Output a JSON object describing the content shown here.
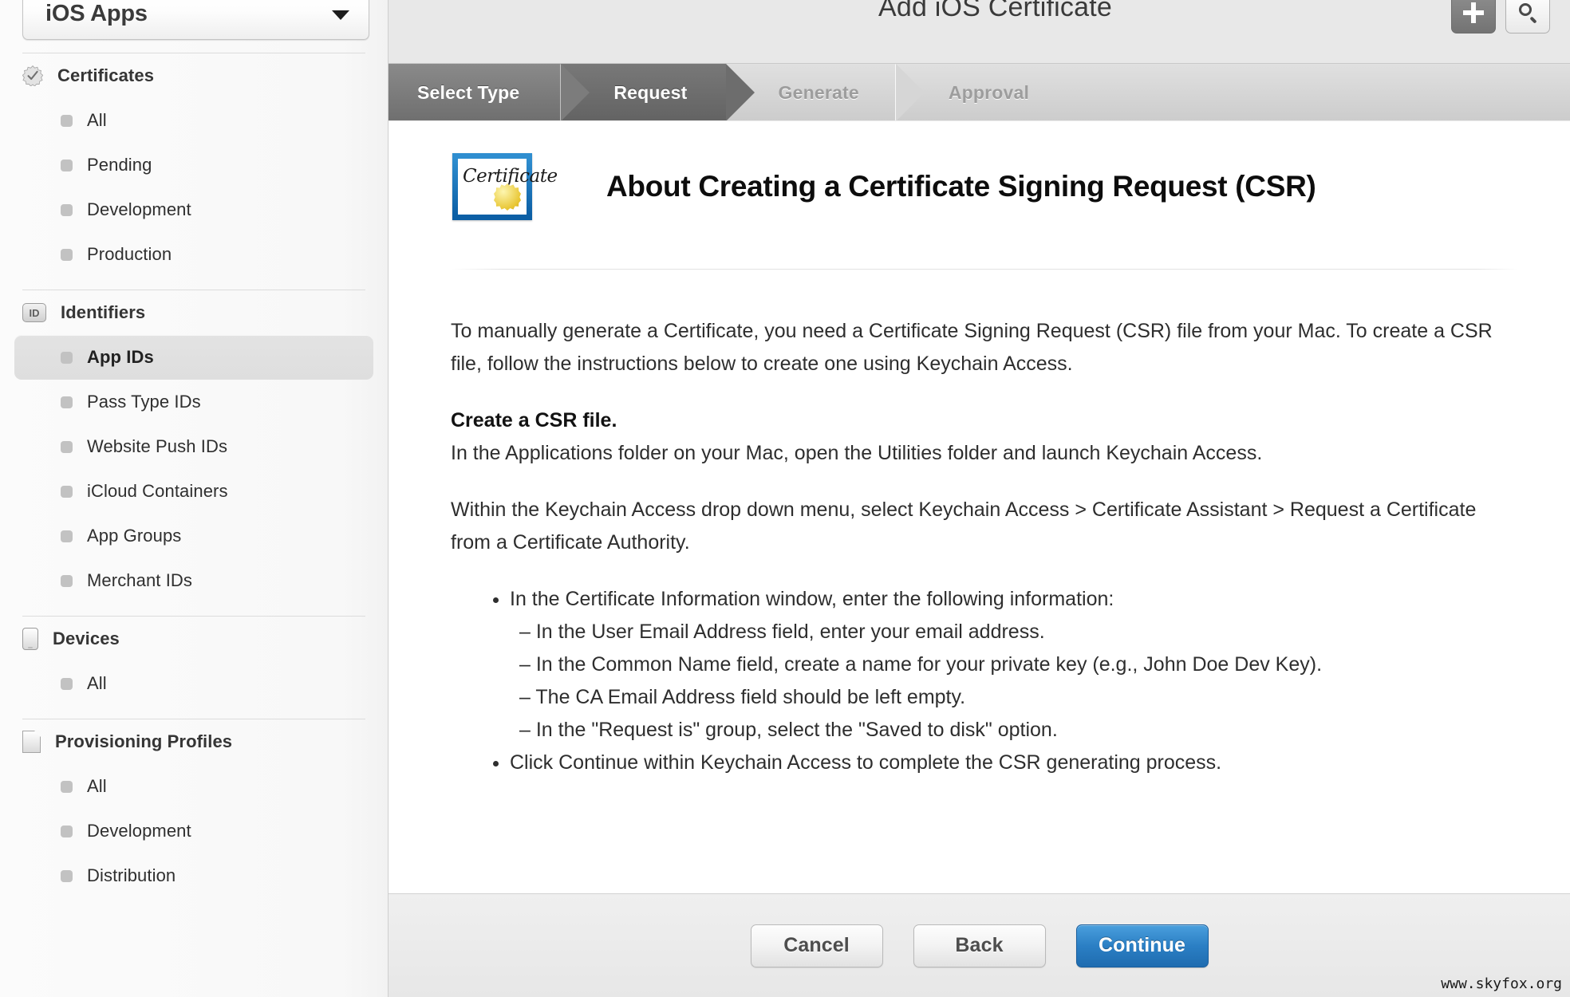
{
  "sidebar": {
    "team_select": {
      "value": "iOS Apps",
      "icon": "chevron-down-icon"
    },
    "groups": [
      {
        "title": "Certificates",
        "icon": "certificate-badge-icon",
        "items": [
          {
            "label": "All",
            "selected": false
          },
          {
            "label": "Pending",
            "selected": false
          },
          {
            "label": "Development",
            "selected": false
          },
          {
            "label": "Production",
            "selected": false
          }
        ]
      },
      {
        "title": "Identifiers",
        "icon": "id-badge-icon",
        "items": [
          {
            "label": "App IDs",
            "selected": true
          },
          {
            "label": "Pass Type IDs",
            "selected": false
          },
          {
            "label": "Website Push IDs",
            "selected": false
          },
          {
            "label": "iCloud Containers",
            "selected": false
          },
          {
            "label": "App Groups",
            "selected": false
          },
          {
            "label": "Merchant IDs",
            "selected": false
          }
        ]
      },
      {
        "title": "Devices",
        "icon": "device-icon",
        "items": [
          {
            "label": "All",
            "selected": false
          }
        ]
      },
      {
        "title": "Provisioning Profiles",
        "icon": "document-icon",
        "items": [
          {
            "label": "All",
            "selected": false
          },
          {
            "label": "Development",
            "selected": false
          },
          {
            "label": "Distribution",
            "selected": false
          }
        ]
      }
    ]
  },
  "topbar": {
    "title": "Add iOS Certificate",
    "add_button": {
      "icon": "plus-icon",
      "label": "+"
    },
    "search_button": {
      "icon": "search-icon"
    }
  },
  "steps": [
    {
      "label": "Select Type",
      "state": "done"
    },
    {
      "label": "Request",
      "state": "active"
    },
    {
      "label": "Generate",
      "state": "todo"
    },
    {
      "label": "Approval",
      "state": "todo"
    }
  ],
  "content": {
    "icon": {
      "name": "certificate-icon",
      "script_text": "Certificate"
    },
    "heading": "About Creating a Certificate Signing Request (CSR)",
    "intro": "To manually generate a Certificate, you need a Certificate Signing Request (CSR) file from your Mac. To create a CSR file, follow the instructions below to create one using Keychain Access.",
    "section_heading": "Create a CSR file.",
    "section_line": "In the Applications folder on your Mac, open the Utilities folder and launch Keychain Access.",
    "menu_path_line": "Within the Keychain Access drop down menu, select Keychain Access > Certificate Assistant > Request a Certificate from a Certificate Authority.",
    "bullets": [
      {
        "text": "In the Certificate Information window, enter the following information:",
        "sub": [
          "– In the User Email Address field, enter your email address.",
          "– In the Common Name field, create a name for your private key (e.g., John Doe Dev Key).",
          "– The CA Email Address field should be left empty.",
          "– In the \"Request is\" group, select the \"Saved to disk\" option."
        ]
      },
      {
        "text": "Click Continue within Keychain Access to complete the CSR generating process.",
        "sub": []
      }
    ]
  },
  "footer": {
    "cancel_label": "Cancel",
    "back_label": "Back",
    "continue_label": "Continue"
  },
  "watermark": "www.skyfox.org",
  "colors": {
    "primary_button": "#2b7fc4",
    "cert_border": "#0c5fa5",
    "cert_seal": "#e8c531",
    "step_active": "#6d6d6d",
    "sidebar_selected": "#e1e1e1"
  }
}
